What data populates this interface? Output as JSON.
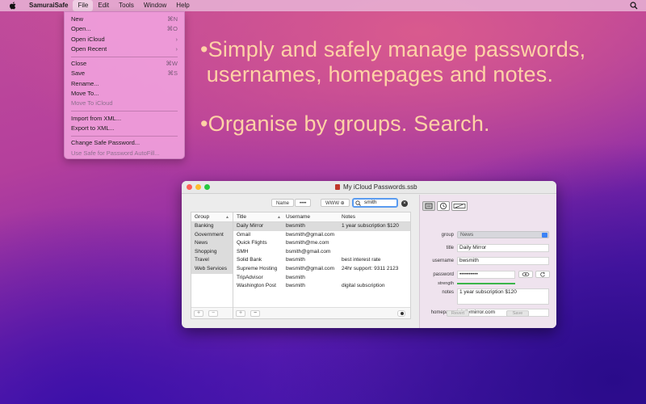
{
  "menubar": {
    "app_name": "SamuraiSafe",
    "items": [
      "File",
      "Edit",
      "Tools",
      "Window",
      "Help"
    ],
    "active": "File"
  },
  "file_menu": {
    "items": [
      {
        "label": "New",
        "shortcut": "⌘N"
      },
      {
        "label": "Open...",
        "shortcut": "⌘O"
      },
      {
        "label": "Open iCloud",
        "shortcut": "›"
      },
      {
        "label": "Open Recent",
        "shortcut": "›"
      },
      {
        "label": "Close",
        "shortcut": "⌘W"
      },
      {
        "label": "Save",
        "shortcut": "⌘S"
      },
      {
        "label": "Rename...",
        "shortcut": ""
      },
      {
        "label": "Move To...",
        "shortcut": ""
      },
      {
        "label": "Move To iCloud",
        "shortcut": ""
      },
      {
        "label": "Import from XML...",
        "shortcut": ""
      },
      {
        "label": "Export to XML...",
        "shortcut": ""
      },
      {
        "label": "Change Safe Password...",
        "shortcut": ""
      },
      {
        "label": "Use Safe for Password AutoFill...",
        "shortcut": ""
      }
    ]
  },
  "marketing": {
    "line1": "•Simply and safely manage passwords,",
    "line2": " usernames, homepages and notes.",
    "line3": "•Organise by groups. Search."
  },
  "window": {
    "title": "My iCloud Passwords.ssb",
    "toolbar": {
      "name_btn": "Name",
      "dots_btn": "••••",
      "www_btn": "WWW",
      "search_value": "smith"
    },
    "groups": {
      "header": "Group",
      "items": [
        "Banking",
        "Government",
        "News",
        "Shopping",
        "Travel",
        "Web Services"
      ]
    },
    "list": {
      "headers": [
        "Title",
        "Username",
        "Notes"
      ],
      "rows": [
        [
          "Daily Mirror",
          "bwsmith",
          "1 year subscription $120"
        ],
        [
          "Gmail",
          "bwsmith@gmail.com",
          ""
        ],
        [
          "Quick Flights",
          "bwsmith@me.com",
          ""
        ],
        [
          "SMH",
          "bsmith@gmail.com",
          ""
        ],
        [
          "Solid Bank",
          "bwsmith",
          "best interest rate"
        ],
        [
          "Supreme Hosting",
          "bwsmith@gmail.com",
          "24hr support: 9311 2123"
        ],
        [
          "TripAdvisor",
          "bwsmith",
          ""
        ],
        [
          "Washington Post",
          "bwsmith",
          "digital subscription"
        ]
      ]
    },
    "detail": {
      "group_label": "group",
      "group_value": "News",
      "title_label": "title",
      "title_value": "Daily Mirror",
      "username_label": "username",
      "username_value": "bwsmith",
      "password_label": "password",
      "password_value": "••••••••••",
      "strength_label": "strength",
      "notes_label": "notes",
      "notes_value": "1 year subscription $120",
      "homepage_label": "homepage",
      "homepage_value": "dailymirror.com",
      "revert_btn": "Revert",
      "save_btn": "Save"
    }
  }
}
